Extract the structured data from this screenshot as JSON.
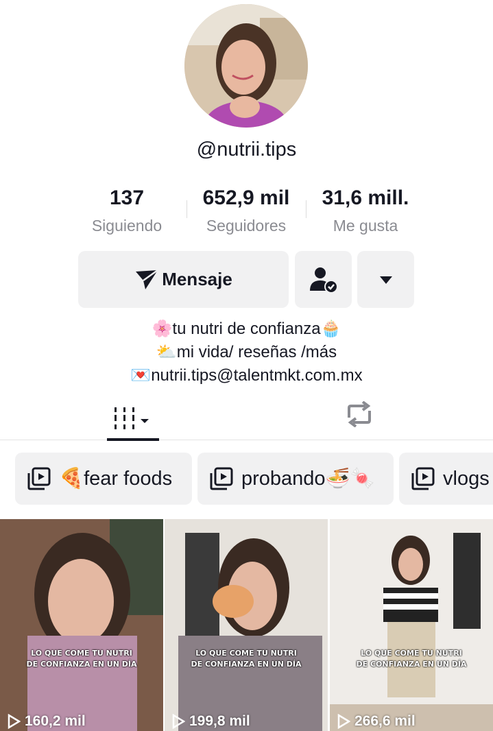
{
  "profile": {
    "username": "@nutrii.tips"
  },
  "stats": [
    {
      "value": "137",
      "label": "Siguiendo"
    },
    {
      "value": "652,9 mil",
      "label": "Seguidores"
    },
    {
      "value": "31,6 mill.",
      "label": "Me gusta"
    }
  ],
  "actions": {
    "message_label": "Mensaje",
    "follow_icon": "person-check-icon",
    "more_icon": "caret-down-icon"
  },
  "bio": {
    "line1": "🌸tu nutri de confianza🧁",
    "line2": "⛅mi vida/ reseñas /más",
    "line3": "💌nutrii.tips@talentmkt.com.mx"
  },
  "tabs": {
    "videos_icon": "grid-bars-icon",
    "repost_icon": "repost-icon"
  },
  "playlists": [
    {
      "label": "🍕fear foods"
    },
    {
      "label": "probando🍜🍬"
    },
    {
      "label": "vlogs"
    }
  ],
  "videos": [
    {
      "caption_line1": "LO QUE COME TU NUTRI",
      "caption_line2": "DE CONFIANZA EN UN DÍA",
      "views": "160,2 mil"
    },
    {
      "caption_line1": "LO QUE COME TU NUTRI",
      "caption_line2": "DE CONFIANZA EN UN DÍA",
      "views": "199,8 mil"
    },
    {
      "caption_line1": "LO QUE COME TU NUTRI",
      "caption_line2": "DE CONFIANZA EN UN DÍA",
      "views": "266,6 mil"
    }
  ],
  "colors": {
    "text": "#161823",
    "muted": "#8a8b91",
    "button_bg": "#f1f1f2"
  }
}
